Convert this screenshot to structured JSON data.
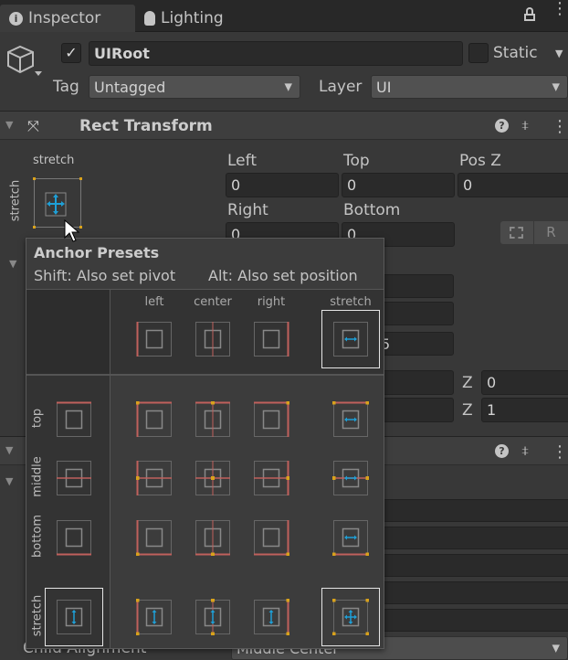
{
  "tabs": [
    {
      "label": "Inspector",
      "icon": "info-icon"
    },
    {
      "label": "Lighting",
      "icon": "bulb-icon"
    }
  ],
  "object": {
    "active": true,
    "name": "UIRoot",
    "static_label": "Static",
    "static": false,
    "tag_label": "Tag",
    "tag": "Untagged",
    "layer_label": "Layer",
    "layer": "UI"
  },
  "rect_transform": {
    "title": "Rect Transform",
    "anchor_h": "stretch",
    "anchor_v": "stretch",
    "fields": [
      {
        "label": "Left",
        "value": "0"
      },
      {
        "label": "Top",
        "value": "0"
      },
      {
        "label": "Pos Z",
        "value": "0"
      },
      {
        "label": "Right",
        "value": "0"
      },
      {
        "label": "Bottom",
        "value": "0"
      }
    ],
    "blueprint_button": "R",
    "partial_value": "5",
    "z_labels": [
      "Z",
      "Z"
    ],
    "z_values": [
      "0",
      "1"
    ]
  },
  "bottom": {
    "label": "Child Alignment",
    "value": "Middle Center"
  },
  "popup": {
    "title": "Anchor Presets",
    "hint_shift": "Shift: Also set pivot",
    "hint_alt": "Alt: Also set position",
    "col_labels": [
      "left",
      "center",
      "right",
      "stretch"
    ],
    "row_labels": [
      "top",
      "middle",
      "bottom",
      "stretch"
    ],
    "selected": [
      "none/stretch",
      "stretch/none",
      "stretch/stretch"
    ]
  },
  "colors": {
    "anchor_line": "#c0605c",
    "anchor_dot": "#d9a21b",
    "arrow": "#1e9fd6"
  }
}
